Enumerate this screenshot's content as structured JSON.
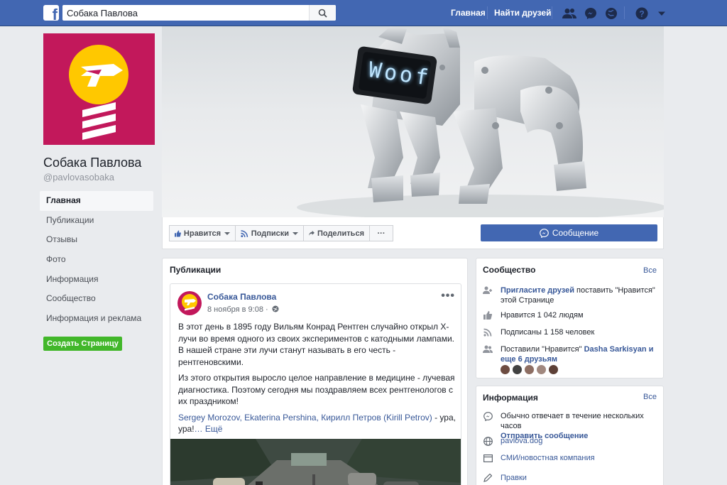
{
  "topbar": {
    "logo_letter": "f",
    "search_value": "Собака Павлова",
    "nav_home": "Главная",
    "nav_find_friends": "Найти друзей",
    "icons": [
      "friends-icon",
      "messenger-icon",
      "notifications-icon",
      "help-icon",
      "account-menu-icon"
    ],
    "accent_color": "#4267b2"
  },
  "profile": {
    "name": "Собака Павлова",
    "handle": "@pavlovasobaka",
    "brand_color": "#c2185b"
  },
  "left_nav": {
    "items": [
      "Главная",
      "Публикации",
      "Отзывы",
      "Фото",
      "Информация",
      "Сообщество",
      "Информация и реклама"
    ],
    "active_index": 0,
    "create_page": "Создать Страницу"
  },
  "cover": {
    "screen_text": "Woof"
  },
  "actions": {
    "like": "Нравится",
    "follow": "Подписки",
    "share": "Поделиться",
    "more": "···",
    "message": "Сообщение"
  },
  "publications": {
    "title": "Публикации",
    "post": {
      "author": "Собака Павлова",
      "date": "8 ноября в 9:08 ·",
      "menu": "•••",
      "paragraph1": "В этот день в 1895 году Вильям Конрад Рентген случайно открыл X-лучи во время одного из своих экспериментов с катодными лампами. В нашей стране эти лучи станут называть в его честь - рентгеновскими.",
      "paragraph2": "Из этого открытия выросло целое направление в медицине - лучевая диагностика. Поэтому сегодня мы поздравляем всех рентгенологов с их праздником!",
      "mentions": "Sergey Morozov, Ekaterina Pershina, Кирилл Петров (Kirill Petrov)",
      "tail": " - ура, ура!",
      "see_more": "… Ещё"
    }
  },
  "community": {
    "title": "Сообщество",
    "all": "Все",
    "invite_link": "Пригласите друзей",
    "invite_text": " поставить \"Нравится\" этой Странице",
    "likes": "Нравится 1 042 людям",
    "followers": "Подписаны 1 158 человек",
    "liked_prefix": "Поставили \"Нравится\" ",
    "liked_friend": "Dasha Sarkisyan и еще 6 друзьям"
  },
  "info": {
    "title": "Информация",
    "all": "Все",
    "response": "Обычно отвечает в течение нескольких часов",
    "send_message": "Отправить сообщение",
    "website": "pavlova.dog",
    "category": "СМИ/новостная компания",
    "edit": "Правки"
  }
}
